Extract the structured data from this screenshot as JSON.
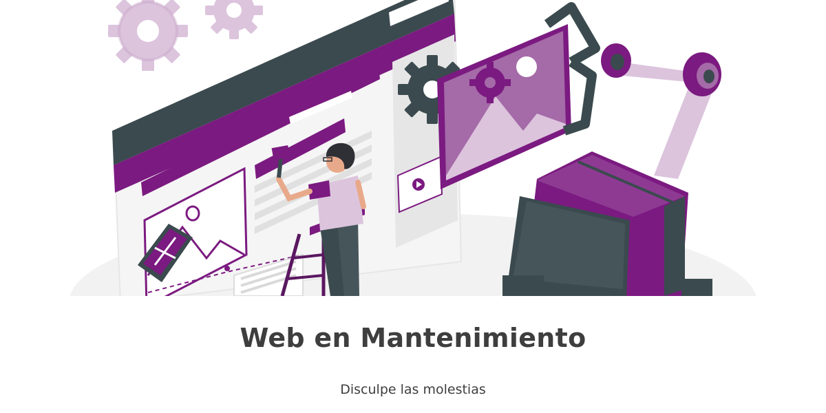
{
  "content": {
    "title": "Web en Mantenimiento",
    "subtitle": "Disculpe las molestias"
  },
  "colors": {
    "accent": "#7b1a80",
    "accent_light": "#a56aa8",
    "accent_pale": "#dcc4dd",
    "dark": "#3b4a4e",
    "text": "#3e3e3e",
    "background": "#ffffff"
  },
  "illustration": {
    "subject": "maintenance-illustration",
    "icons": [
      "gear-icon",
      "image-placeholder-icon",
      "play-icon",
      "wrench-screwdriver-icon",
      "robot-arm",
      "paint-brush",
      "ladder"
    ]
  }
}
